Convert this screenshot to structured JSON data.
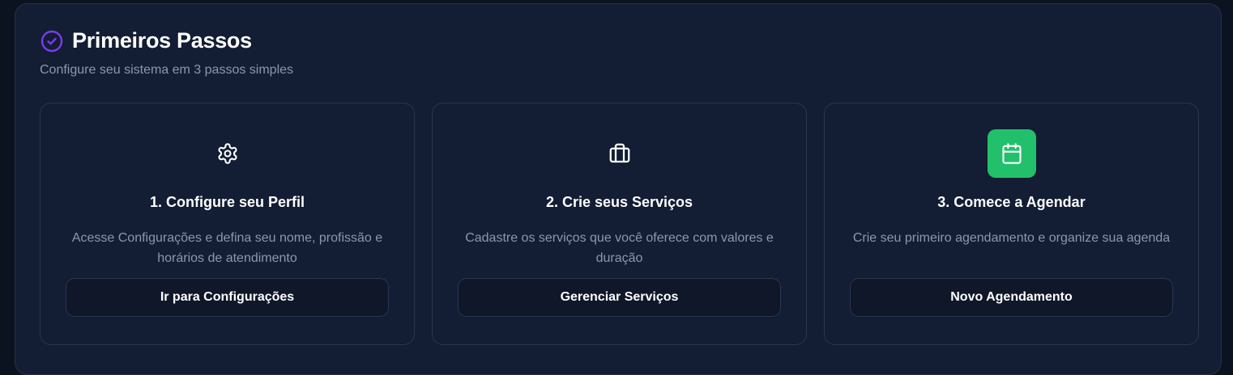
{
  "section": {
    "icon": "check-circle-icon",
    "title": "Primeiros Passos",
    "subtitle": "Configure seu sistema em 3 passos simples"
  },
  "steps": [
    {
      "icon": "gear-icon",
      "title": "1. Configure seu Perfil",
      "description": "Acesse Configurações e defina seu nome, profissão e horários de atendimento",
      "button_label": "Ir para Configurações"
    },
    {
      "icon": "briefcase-icon",
      "title": "2. Crie seus Serviços",
      "description": "Cadastre os serviços que você oferece com valores e duração",
      "button_label": "Gerenciar Serviços"
    },
    {
      "icon": "calendar-icon",
      "title": "3. Comece a Agendar",
      "description": "Crie seu primeiro agendamento e organize sua agenda",
      "button_label": "Novo Agendamento",
      "highlighted": true
    }
  ],
  "colors": {
    "accent_purple": "#7c3aed",
    "success_green": "#22c06b",
    "background": "#131d33"
  }
}
